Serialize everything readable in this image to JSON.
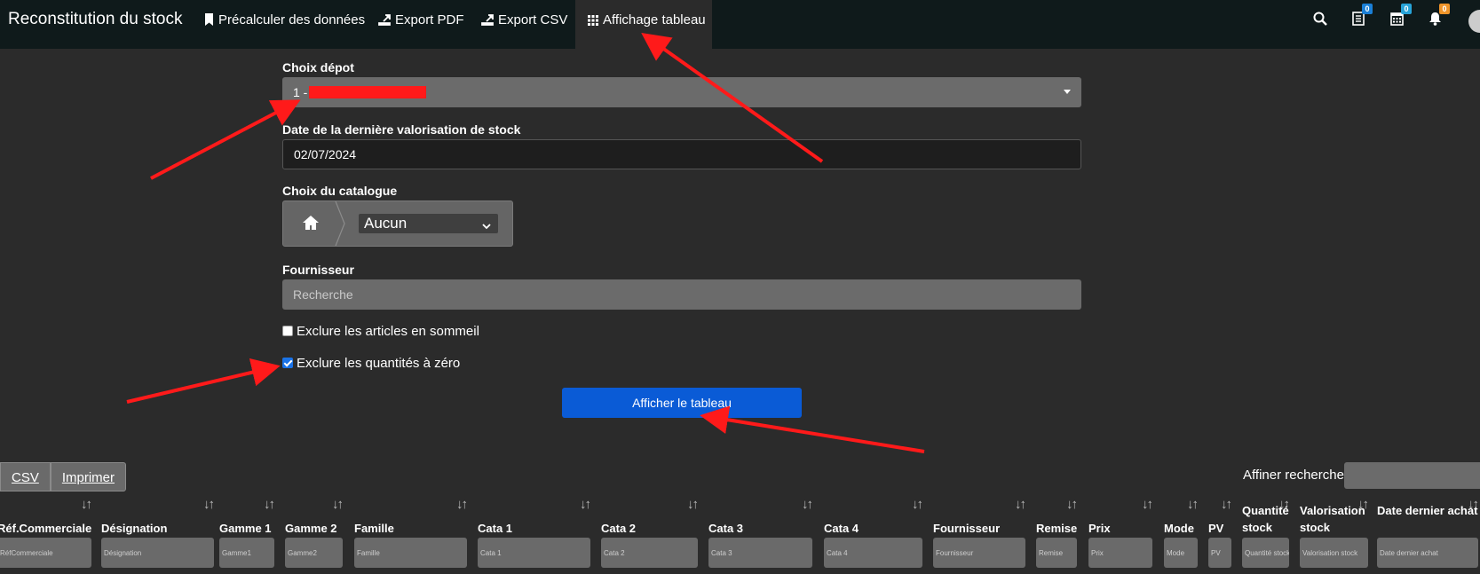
{
  "navbar": {
    "title": "Reconstitution du stock",
    "items": [
      {
        "label": "Précalculer des données",
        "icon": "bookmark-icon"
      },
      {
        "label": "Export PDF",
        "icon": "export-icon"
      },
      {
        "label": "Export CSV",
        "icon": "export-icon"
      },
      {
        "label": "Affichage tableau",
        "icon": "grid-icon",
        "active": true
      }
    ],
    "badges": {
      "list": "0",
      "calendar": "0",
      "bell": "0"
    },
    "badge_colors": {
      "list": "#1a7fd6",
      "calendar": "#27a3d8",
      "bell": "#f0952a"
    }
  },
  "form": {
    "depot": {
      "label": "Choix dépot",
      "value": "1 -"
    },
    "last_valuation": {
      "label": "Date de la dernière valorisation de stock",
      "value": "02/07/2024"
    },
    "catalog": {
      "label": "Choix du catalogue",
      "value": "Aucun"
    },
    "supplier": {
      "label": "Fournisseur",
      "placeholder": "Recherche"
    },
    "exclude_sleeping": {
      "label": "Exclure les articles en sommeil",
      "checked": false
    },
    "exclude_zero": {
      "label": "Exclure les quantités à zéro",
      "checked": true
    },
    "show_button": "Afficher le tableau"
  },
  "toolbar": {
    "csv": "CSV",
    "print": "Imprimer",
    "refine_label": "Affiner recherche"
  },
  "table": {
    "columns": [
      {
        "title": "Réf.Commerciale",
        "filter": "RéfCommerciale"
      },
      {
        "title": "Désignation",
        "filter": "Désignation"
      },
      {
        "title": "Gamme 1",
        "filter": "Gamme1"
      },
      {
        "title": "Gamme 2",
        "filter": "Gamme2"
      },
      {
        "title": "Famille",
        "filter": "Famille"
      },
      {
        "title": "Cata 1",
        "filter": "Cata 1"
      },
      {
        "title": "Cata 2",
        "filter": "Cata 2"
      },
      {
        "title": "Cata 3",
        "filter": "Cata 3"
      },
      {
        "title": "Cata 4",
        "filter": "Cata 4"
      },
      {
        "title": "Fournisseur",
        "filter": "Fournisseur"
      },
      {
        "title": "Remise",
        "filter": "Remise"
      },
      {
        "title": "Prix",
        "filter": "Prix"
      },
      {
        "title": "Mode",
        "filter": "Mode"
      },
      {
        "title": "PV",
        "filter": "PV"
      },
      {
        "title": "Quantité stock",
        "filter": "Quantité stock"
      },
      {
        "title": "Valorisation stock",
        "filter": "Valorisation stock"
      },
      {
        "title": "Date dernier achat",
        "filter": "Date dernier achat"
      }
    ]
  },
  "colors": {
    "accent": "#0a5bd6",
    "navbar": "#0f1a1b",
    "background": "#2b2b2b",
    "annotation": "#ff1a1a"
  }
}
